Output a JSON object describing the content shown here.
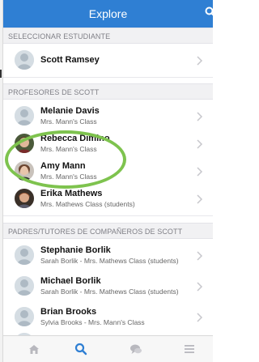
{
  "header": {
    "title": "Explore",
    "search_icon": "search-icon"
  },
  "sections": {
    "student": "SELECCIONAR ESTUDIANTE",
    "teachers": "PROFESORES DE SCOTT",
    "parents": "PADRES/TUTORES DE COMPAÑEROS DE SCOTT"
  },
  "student_row": {
    "name": "Scott Ramsey"
  },
  "teachers": [
    {
      "name": "Melanie Davis",
      "sub": "Mrs. Mann's Class",
      "avatar": "default"
    },
    {
      "name": "Rebecca Dimino",
      "sub": "Mrs. Mann's Class",
      "avatar": "photo"
    },
    {
      "name": "Amy Mann",
      "sub": "Mrs. Mann's Class",
      "avatar": "photo"
    },
    {
      "name": "Erika Mathews",
      "sub": "Mrs. Mathews Class (students)",
      "avatar": "photo"
    }
  ],
  "parents": [
    {
      "name": "Stephanie Borlik",
      "sub": "Sarah Borlik - Mrs. Mathews Class (students)"
    },
    {
      "name": "Michael  Borlik",
      "sub": "Sarah Borlik - Mrs. Mathews Class (students)"
    },
    {
      "name": "Brian Brooks",
      "sub": "Sylvia Brooks - Mrs. Mann's Class"
    }
  ],
  "tabbar": {
    "items": [
      "home-icon",
      "search-icon",
      "chat-icon",
      "menu-icon"
    ],
    "active_color": "#2f7fd3"
  },
  "colors": {
    "accent": "#2f7fd3",
    "highlight": "#7ec34e"
  }
}
